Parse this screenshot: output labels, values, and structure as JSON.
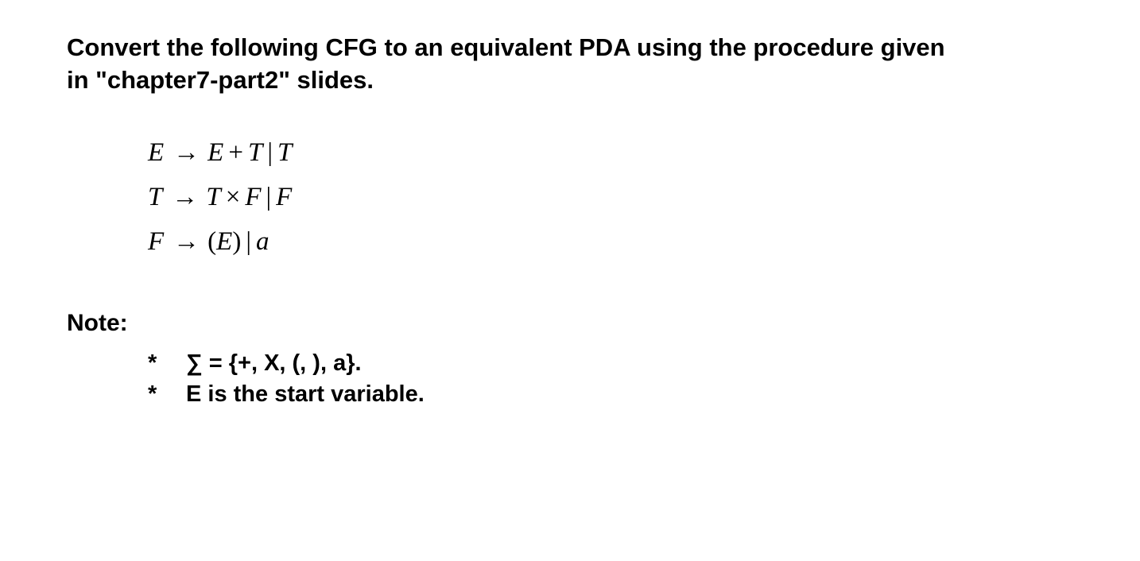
{
  "instruction": {
    "line1": "Convert the following CFG to an equivalent PDA using the procedure given",
    "line2": "in \"chapter7-part2\" slides."
  },
  "grammar": {
    "rule1": {
      "lhs": "E",
      "arrow": "→",
      "rhs1_a": "E",
      "plus": "+",
      "rhs1_b": "T",
      "bar": "|",
      "rhs2": "T"
    },
    "rule2": {
      "lhs": "T",
      "arrow": "→",
      "rhs1_a": "T",
      "times": "×",
      "rhs1_b": "F",
      "bar": "|",
      "rhs2": "F"
    },
    "rule3": {
      "lhs": "F",
      "arrow": "→",
      "lparen": "(",
      "inner": "E",
      "rparen": ")",
      "bar": "|",
      "rhs2": "a"
    }
  },
  "note_heading": "Note:",
  "notes": {
    "item1": {
      "bullet": "*",
      "sigma": "∑",
      "text": " = {+, X, (, ), a}."
    },
    "item2": {
      "bullet": "*",
      "text": "E is the start variable."
    }
  }
}
